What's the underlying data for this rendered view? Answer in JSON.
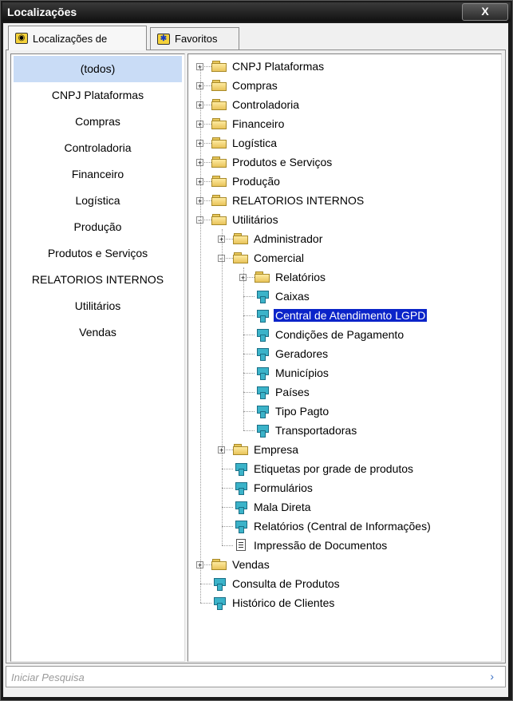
{
  "window": {
    "title": "Localizações",
    "close_label": "X"
  },
  "tabs": [
    {
      "label": "Localizações de",
      "icon": "camera-icon",
      "active": true
    },
    {
      "label": "Favoritos",
      "icon": "star-icon",
      "active": false
    }
  ],
  "categories": {
    "selected": "(todos)",
    "items": [
      "(todos)",
      "CNPJ Plataformas",
      "Compras",
      "Controladoria",
      "Financeiro",
      "Logística",
      "Produção",
      "Produtos e Serviços",
      "RELATORIOS INTERNOS",
      "Utilitários",
      "Vendas"
    ]
  },
  "tree": {
    "selected": "Central de Atendimento LGPD",
    "nodes": [
      {
        "label": "CNPJ Plataformas",
        "level": 0,
        "kind": "folder",
        "expander": "+"
      },
      {
        "label": "Compras",
        "level": 0,
        "kind": "folder",
        "expander": "+"
      },
      {
        "label": "Controladoria",
        "level": 0,
        "kind": "folder",
        "expander": "+"
      },
      {
        "label": "Financeiro",
        "level": 0,
        "kind": "folder",
        "expander": "+"
      },
      {
        "label": "Logística",
        "level": 0,
        "kind": "folder",
        "expander": "+"
      },
      {
        "label": "Produtos e Serviços",
        "level": 0,
        "kind": "folder",
        "expander": "+"
      },
      {
        "label": "Produção",
        "level": 0,
        "kind": "folder",
        "expander": "+"
      },
      {
        "label": "RELATORIOS INTERNOS",
        "level": 0,
        "kind": "folder",
        "expander": "+"
      },
      {
        "label": "Utilitários",
        "level": 0,
        "kind": "folder",
        "expander": "-"
      },
      {
        "label": "Administrador",
        "level": 1,
        "kind": "folder",
        "expander": "+"
      },
      {
        "label": "Comercial",
        "level": 1,
        "kind": "folder",
        "expander": "-"
      },
      {
        "label": "Relatórios",
        "level": 2,
        "kind": "folder",
        "expander": "+"
      },
      {
        "label": "Caixas",
        "level": 2,
        "kind": "report",
        "expander": ""
      },
      {
        "label": "Central de Atendimento LGPD",
        "level": 2,
        "kind": "report",
        "expander": ""
      },
      {
        "label": "Condições de Pagamento",
        "level": 2,
        "kind": "report",
        "expander": ""
      },
      {
        "label": "Geradores",
        "level": 2,
        "kind": "report",
        "expander": ""
      },
      {
        "label": "Municípios",
        "level": 2,
        "kind": "report",
        "expander": ""
      },
      {
        "label": "Países",
        "level": 2,
        "kind": "report",
        "expander": ""
      },
      {
        "label": "Tipo Pagto",
        "level": 2,
        "kind": "report",
        "expander": ""
      },
      {
        "label": "Transportadoras",
        "level": 2,
        "kind": "report",
        "expander": ""
      },
      {
        "label": "Empresa",
        "level": 1,
        "kind": "folder",
        "expander": "+"
      },
      {
        "label": "Etiquetas por grade de produtos",
        "level": 1,
        "kind": "report",
        "expander": ""
      },
      {
        "label": "Formulários",
        "level": 1,
        "kind": "report",
        "expander": ""
      },
      {
        "label": "Mala Direta",
        "level": 1,
        "kind": "report",
        "expander": ""
      },
      {
        "label": "Relatórios (Central de Informações)",
        "level": 1,
        "kind": "report",
        "expander": ""
      },
      {
        "label": "Impressão de Documentos",
        "level": 1,
        "kind": "document",
        "expander": ""
      },
      {
        "label": "Vendas",
        "level": 0,
        "kind": "folder",
        "expander": "+"
      },
      {
        "label": "Consulta de Produtos",
        "level": 0,
        "kind": "report",
        "expander": ""
      },
      {
        "label": "Histórico de Clientes",
        "level": 0,
        "kind": "report",
        "expander": ""
      }
    ]
  },
  "search": {
    "placeholder": "Iniciar Pesquisa",
    "go_symbol": "›"
  }
}
